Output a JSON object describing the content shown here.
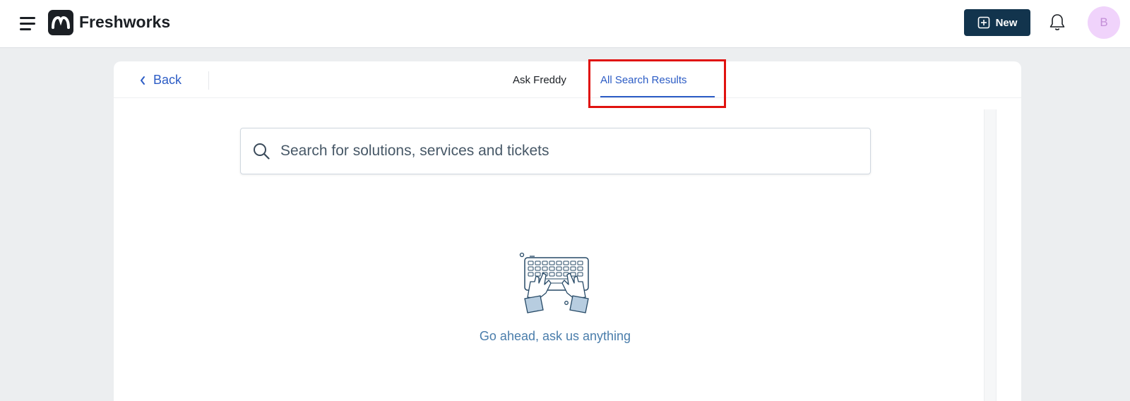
{
  "header": {
    "brand": "Freshworks",
    "new_button_label": "New",
    "avatar_initial": "B"
  },
  "tabs": {
    "back_label": "Back",
    "items": [
      {
        "label": "Ask Freddy",
        "active": false
      },
      {
        "label": "All Search Results",
        "active": true
      }
    ]
  },
  "search": {
    "placeholder": "Search for solutions, services and tickets",
    "value": ""
  },
  "empty_state": {
    "message": "Go ahead, ask us anything",
    "illustration": "keyboard-typing-illustration"
  },
  "icons": {
    "menu": "hamburger-icon",
    "logo": "freshworks-logo-icon",
    "new": "plus-square-icon",
    "notifications": "bell-icon",
    "back": "chevron-left-icon",
    "search": "search-icon"
  },
  "colors": {
    "primary_button": "#12344d",
    "accent": "#2c5cc5",
    "highlight": "#e0120f",
    "avatar_bg": "#f0d3fb"
  }
}
